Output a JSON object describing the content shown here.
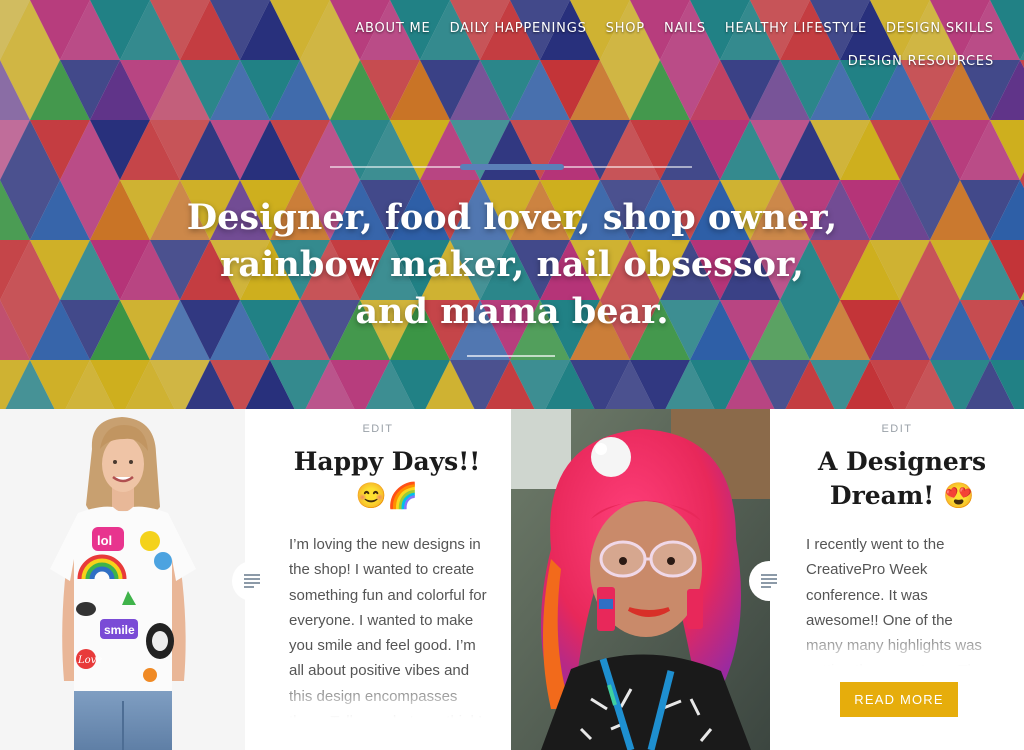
{
  "nav": {
    "items": [
      "ABOUT ME",
      "DAILY HAPPENINGS",
      "SHOP",
      "NAILS",
      "HEALTHY LIFESTYLE",
      "DESIGN SKILLS",
      "DESIGN RESOURCES"
    ]
  },
  "hero": {
    "tagline": "Designer, food lover, shop owner, rainbow maker, nail obsessor, and mama bear."
  },
  "posts": [
    {
      "edit_label": "EDIT",
      "title": "Happy Days!! 😊🌈",
      "excerpt": "I’m loving the new designs in the shop! I wanted to create something fun and colorful for everyone. I wanted to make you smile and feel good. I’m all about positive vibes and this design encompasses them. Tell me what you think!",
      "image_alt": "Woman wearing a colorful sticker-print t-shirt"
    },
    {
      "edit_label": "EDIT",
      "title": "A Designers Dream! 😍",
      "excerpt": "I recently went to the CreativePro Week conference. It was awesome!! One of the many many highlights was getting them on stage. The",
      "read_more": "READ MORE",
      "image_alt": "Woman with bright pink hair and glasses"
    }
  ],
  "colors": {
    "accent": "#e6ad0c",
    "hero_palette": [
      "#e83a3a",
      "#f08a24",
      "#f6d21a",
      "#3fb34a",
      "#1f9a9a",
      "#2f6fc4",
      "#27358f",
      "#6d3a9e",
      "#d63a8a",
      "#e24a70"
    ]
  },
  "icons": {
    "format": "standard-post-icon"
  }
}
